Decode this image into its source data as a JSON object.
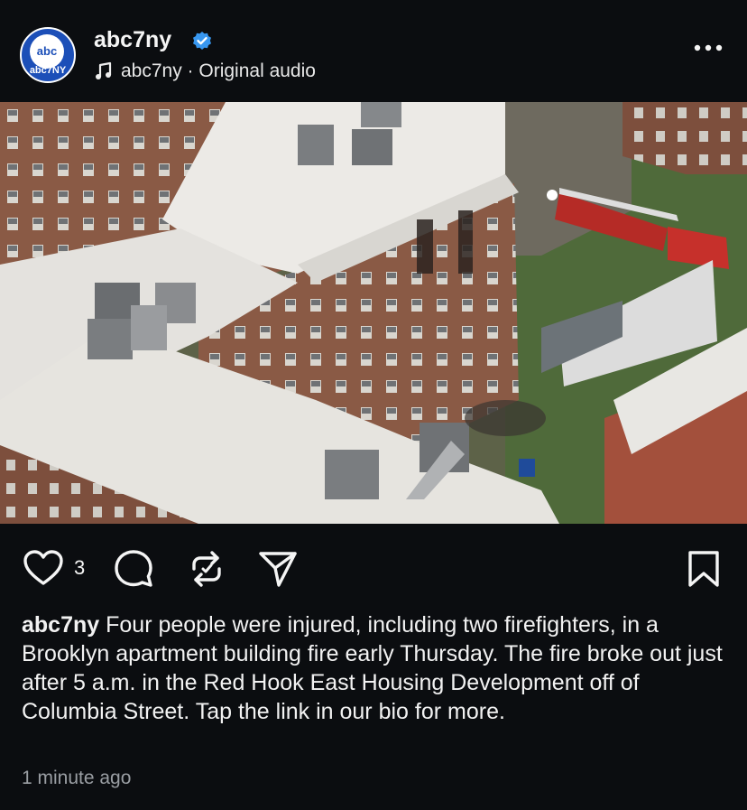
{
  "post": {
    "username": "abc7ny",
    "avatar_text": "abc7NY",
    "avatar_logo": "abc",
    "audio_label": "abc7ny · Original audio",
    "like_count": "3",
    "caption_user": "abc7ny",
    "caption_text": " Four people were injured, including two firefighters, in a Brooklyn apartment building fire early Thursday. The fire broke out just after 5 a.m. in the Red Hook East Housing Development off of Columbia Street. Tap the link in our bio for more.",
    "timestamp": "1 minute ago"
  },
  "colors": {
    "background": "#0b0d10",
    "verified": "#3897f0",
    "brand_blue": "#1c4fb8"
  },
  "icons": [
    "verified-badge-icon",
    "music-note-icon",
    "more-options-icon",
    "mute-icon",
    "heart-icon",
    "comment-icon",
    "repost-icon",
    "share-icon",
    "bookmark-icon"
  ]
}
